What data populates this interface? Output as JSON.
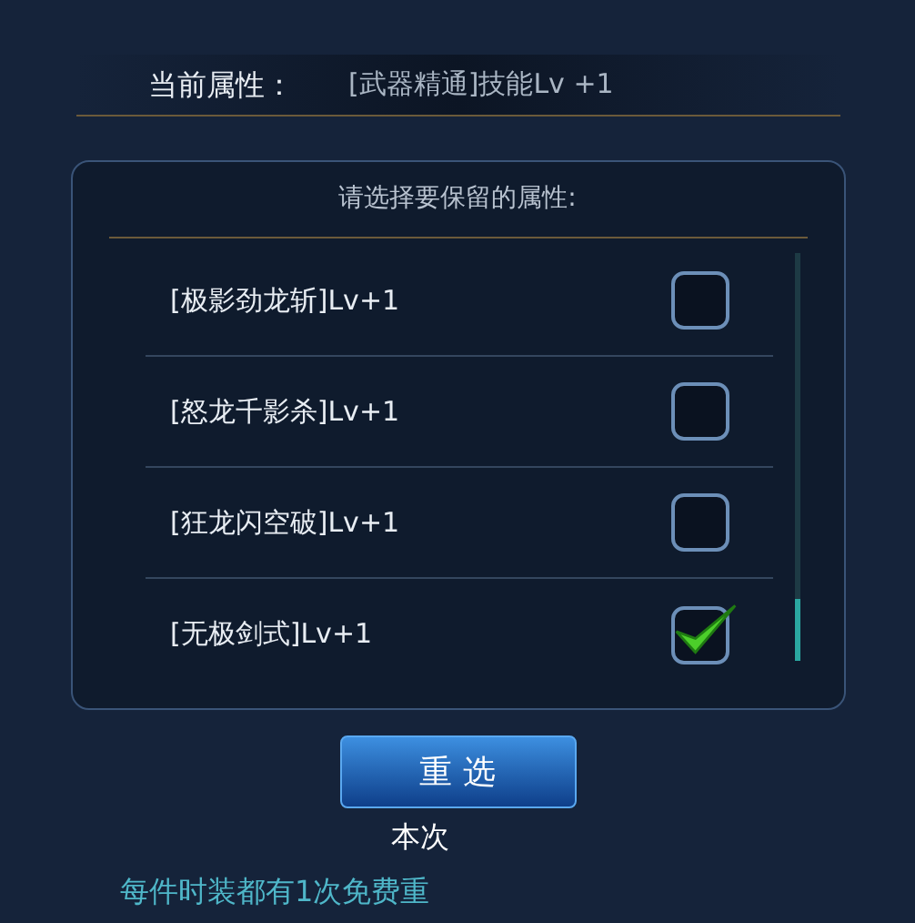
{
  "current": {
    "label": "当前属性：",
    "value": "[武器精通]技能Lv +1"
  },
  "panel": {
    "title": "请选择要保留的属性:",
    "options": [
      {
        "label": "[极影劲龙斩]Lv+1",
        "checked": false
      },
      {
        "label": "[怒龙千影杀]Lv+1",
        "checked": false
      },
      {
        "label": "[狂龙闪空破]Lv+1",
        "checked": false
      },
      {
        "label": "[无极剑式]Lv+1",
        "checked": true
      }
    ]
  },
  "button": "重 选",
  "note": "本次",
  "footer": "每件时装都有1次免费重"
}
